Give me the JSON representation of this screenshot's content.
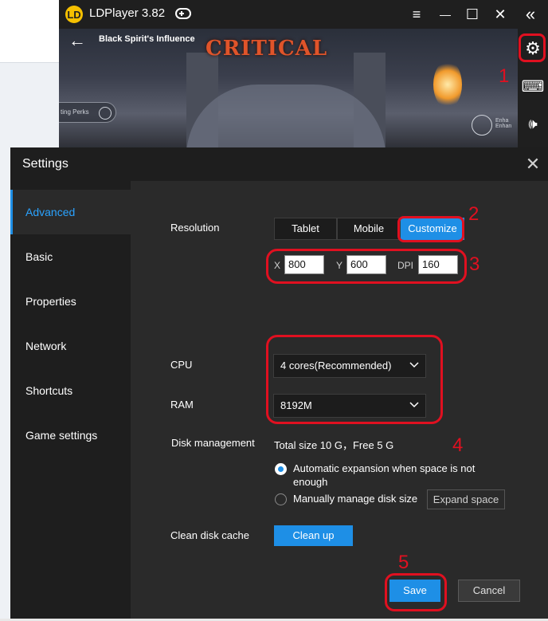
{
  "app": {
    "title": "LDPlayer 3.82",
    "logo_glyph": "LD",
    "titlebar_buttons": [
      {
        "name": "menu-icon",
        "glyph": "≡"
      },
      {
        "name": "minimize-icon",
        "glyph": "—"
      },
      {
        "name": "maximize-icon",
        "glyph": "☐"
      },
      {
        "name": "close-icon",
        "glyph": "✕"
      },
      {
        "name": "collapse-sidebar-icon",
        "glyph": "«"
      }
    ]
  },
  "game": {
    "back_glyph": "←",
    "quest_title": "Black Spirit's Influence",
    "hit_text": "CRITICAL",
    "perks_label": "ting Perks",
    "enhance_label_1": "Enha",
    "enhance_label_2": "Enhan"
  },
  "side_toolbar": [
    {
      "name": "settings-gear-icon",
      "glyph": "⚙"
    },
    {
      "name": "keyboard-mapping-icon",
      "glyph": "⌨"
    },
    {
      "name": "volume-up-icon",
      "glyph": "🕪"
    }
  ],
  "annotations": [
    "1",
    "2",
    "3",
    "4",
    "5"
  ],
  "settings": {
    "title": "Settings",
    "close_glyph": "✕",
    "nav": [
      "Advanced",
      "Basic",
      "Properties",
      "Network",
      "Shortcuts",
      "Game settings"
    ],
    "active_nav": "Advanced",
    "resolution": {
      "label": "Resolution",
      "options": [
        "Tablet",
        "Mobile",
        "Customize"
      ],
      "selected": "Customize",
      "x_label": "X",
      "x_value": "800",
      "y_label": "Y",
      "y_value": "600",
      "dpi_label": "DPI",
      "dpi_value": "160"
    },
    "cpu": {
      "label": "CPU",
      "value": "4 cores(Recommended)"
    },
    "ram": {
      "label": "RAM",
      "value": "8192M"
    },
    "disk": {
      "label": "Disk management",
      "info": "Total size 10 G，Free 5 G",
      "auto_option": "Automatic expansion when space is not enough",
      "manual_option": "Manually manage disk size",
      "expand_button": "Expand space",
      "selected": "auto"
    },
    "cache": {
      "label": "Clean disk cache",
      "button": "Clean up"
    },
    "save_button": "Save",
    "cancel_button": "Cancel"
  },
  "colors": {
    "accent": "#1e8fe6",
    "annotation_red": "#e01020",
    "dialog_bg": "#2a2a2a",
    "nav_bg": "#1e1e1e"
  }
}
